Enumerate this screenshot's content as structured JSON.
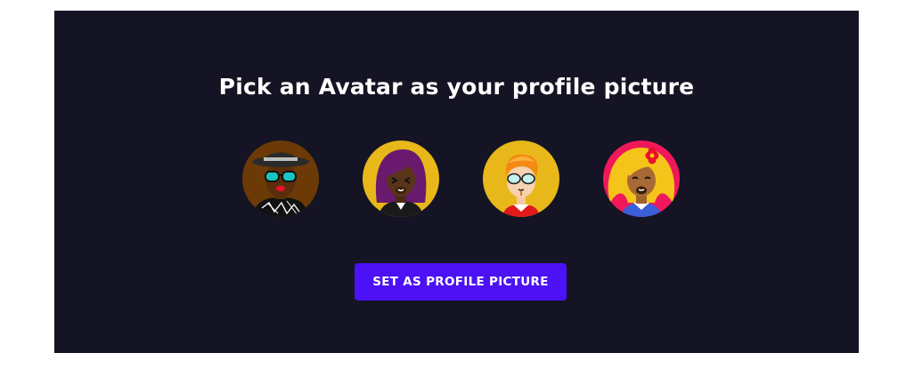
{
  "heading": "Pick an Avatar as your profile picture",
  "set_button_label": "SET AS PROFILE PICTURE",
  "avatars": [
    {
      "icon": "avatar-hat-sunglasses-icon",
      "bg": "#6b3a06"
    },
    {
      "icon": "avatar-purple-hair-icon",
      "bg": "#e8b81a"
    },
    {
      "icon": "avatar-ginger-glasses-icon",
      "bg": "#e8b81a"
    },
    {
      "icon": "avatar-blonde-flower-icon",
      "bg": "#f0185a"
    }
  ],
  "colors": {
    "panel_bg": "#141424",
    "button_bg": "#4c12f5",
    "text": "#ffffff"
  }
}
